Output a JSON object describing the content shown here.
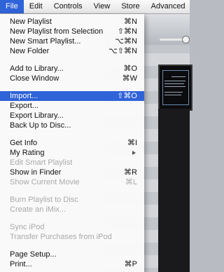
{
  "menubar": {
    "items": [
      "File",
      "Edit",
      "Controls",
      "View",
      "Store",
      "Advanced"
    ],
    "active": "File"
  },
  "menu": {
    "items": [
      {
        "label": "New Playlist",
        "shortcut": "⌘N",
        "disabled": false
      },
      {
        "label": "New Playlist from Selection",
        "shortcut": "⇧⌘N",
        "disabled": false
      },
      {
        "label": "New Smart Playlist...",
        "shortcut": "⌥⌘N",
        "disabled": false
      },
      {
        "label": "New Folder",
        "shortcut": "⌥⇧⌘N",
        "disabled": false
      },
      {
        "label": "Add to Library...",
        "shortcut": "⌘O",
        "disabled": false
      },
      {
        "label": "Close Window",
        "shortcut": "⌘W",
        "disabled": false
      },
      {
        "label": "Import...",
        "shortcut": "⇧⌘O",
        "disabled": false,
        "highlighted": true
      },
      {
        "label": "Export...",
        "shortcut": "",
        "disabled": false
      },
      {
        "label": "Export Library...",
        "shortcut": "",
        "disabled": false
      },
      {
        "label": "Back Up to Disc...",
        "shortcut": "",
        "disabled": false
      },
      {
        "label": "Get Info",
        "shortcut": "⌘I",
        "disabled": false
      },
      {
        "label": "My Rating",
        "shortcut": "",
        "disabled": false,
        "submenu": true
      },
      {
        "label": "Edit Smart Playlist",
        "shortcut": "",
        "disabled": true
      },
      {
        "label": "Show in Finder",
        "shortcut": "⌘R",
        "disabled": false
      },
      {
        "label": "Show Current Movie",
        "shortcut": "⌘L",
        "disabled": true
      },
      {
        "label": "Burn Playlist to Disc",
        "shortcut": "",
        "disabled": true
      },
      {
        "label": "Create an iMix...",
        "shortcut": "",
        "disabled": true
      },
      {
        "label": "Sync iPod",
        "shortcut": "",
        "disabled": true
      },
      {
        "label": "Transfer Purchases from iPod",
        "shortcut": "",
        "disabled": true
      },
      {
        "label": "Page Setup...",
        "shortcut": "",
        "disabled": false
      },
      {
        "label": "Print...",
        "shortcut": "⌘P",
        "disabled": false
      }
    ]
  },
  "colors": {
    "highlight": "#2f63d8",
    "disabled_text": "#a9a9a9"
  }
}
